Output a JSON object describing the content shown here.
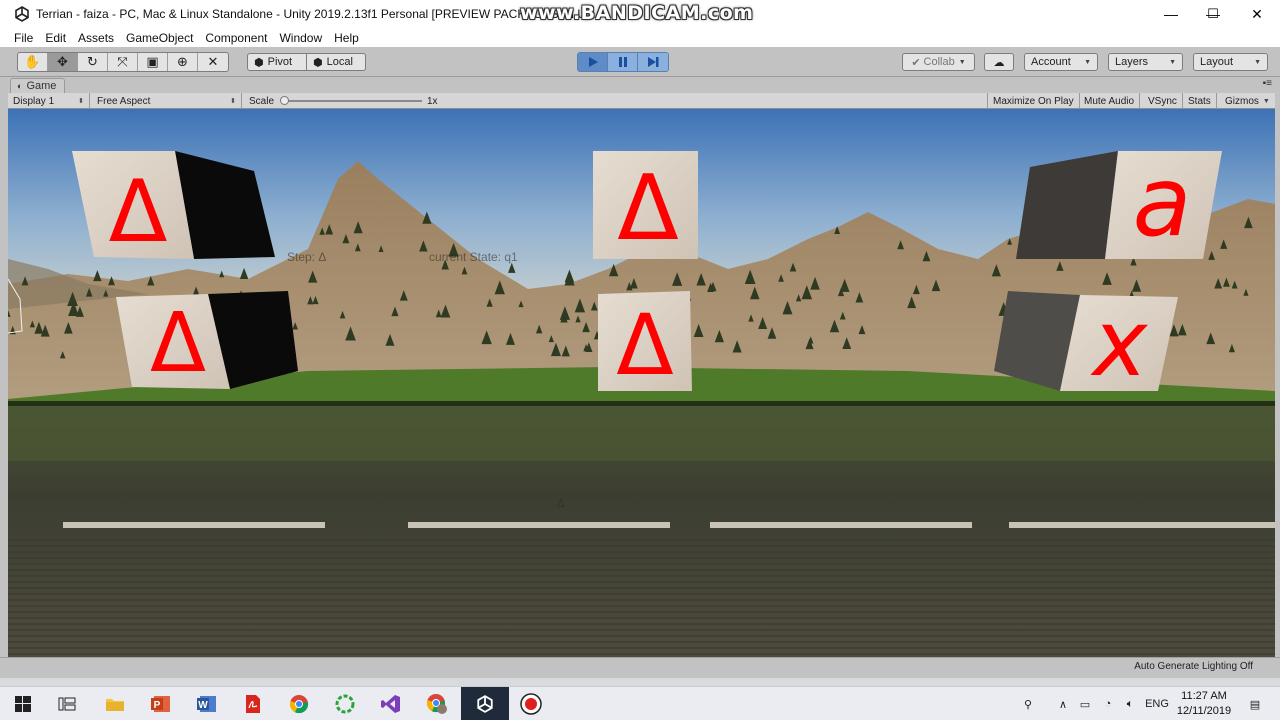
{
  "window": {
    "title": "Terrian - faiza - PC, Mac & Linux Standalone - Unity 2019.2.13f1 Personal [PREVIEW PACKAGES IN U",
    "watermark": "www.BANDICAM.com",
    "controls": [
      "—",
      "☐",
      "✕"
    ]
  },
  "menu": [
    "File",
    "Edit",
    "Assets",
    "GameObject",
    "Component",
    "Window",
    "Help"
  ],
  "toolbar": {
    "pivot_label": "Pivot",
    "local_label": "Local",
    "collab_label": "Collab",
    "account_label": "Account",
    "layers_label": "Layers",
    "layout_label": "Layout"
  },
  "game_tab": {
    "label": "Game"
  },
  "game_bar": {
    "display": "Display 1",
    "aspect": "Free Aspect",
    "scale_label": "Scale",
    "scale_value": "1x",
    "scale_level": 0.0,
    "maximize": "Maximize On Play",
    "mute": "Mute Audio",
    "vsync": "VSync",
    "stats": "Stats",
    "gizmos": "Gizmos"
  },
  "scene": {
    "cube_symbols": [
      "Δ",
      "Δ",
      "Δ",
      "Δ",
      "a",
      "x"
    ],
    "step_text": "Step: Δ",
    "state_text": "current State: q1",
    "tape_marker": "Δ",
    "colors": {
      "symbol": "#ff0000",
      "sky_top": "#3a72b8",
      "grass": "#3e6a22"
    }
  },
  "status": {
    "lighting": "Auto Generate Lighting Off"
  },
  "taskbar": {
    "apps": [
      "windows-start",
      "task-view",
      "file-explorer",
      "powerpoint",
      "word",
      "acrobat",
      "chrome",
      "app-green-ring",
      "visual-studio",
      "chrome-alt",
      "unity",
      "recorder"
    ],
    "language": "ENG",
    "time": "11:27 AM",
    "date": "12/11/2019"
  }
}
